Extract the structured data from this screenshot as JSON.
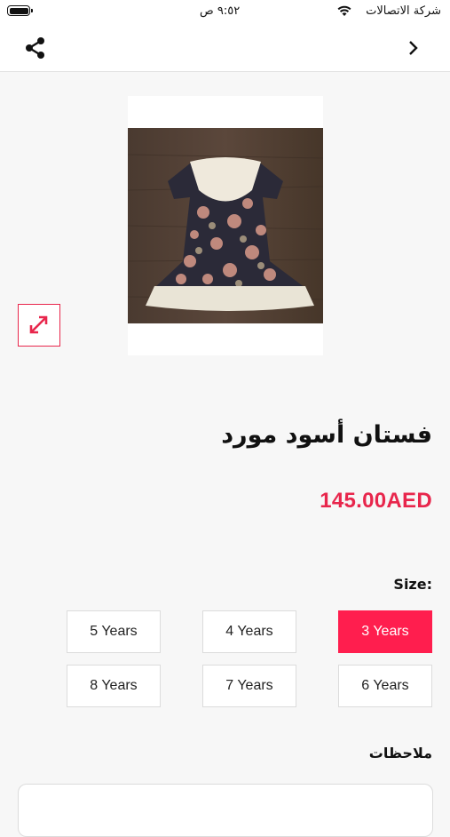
{
  "status_bar": {
    "time": "٩:٥٢ ص",
    "carrier": "شركة الاتصالات"
  },
  "nav": {
    "icons": [
      "share-icon",
      "back-chevron-icon"
    ]
  },
  "product": {
    "image_alt": "floral dress photo",
    "title": "فستان أسود مورد",
    "price": "145.00AED"
  },
  "size": {
    "label": "Size:",
    "options": [
      "3 Years",
      "4 Years",
      "5 Years",
      "6 Years",
      "7 Years",
      "8 Years"
    ],
    "selected": "3 Years"
  },
  "notes": {
    "label": "ملاحظات"
  },
  "colors": {
    "accent": "#ff1e4e",
    "price": "#e8264c"
  }
}
